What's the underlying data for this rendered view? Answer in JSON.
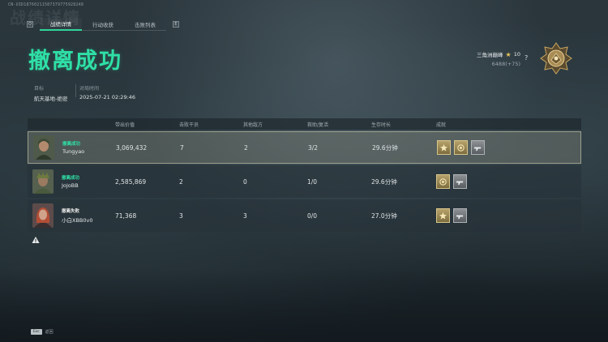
{
  "uid": "CN-UID18760211587379775928248",
  "ghost_title": "战绩详情",
  "tabbar": {
    "left_key": "Q",
    "right_key": "E",
    "tabs": [
      {
        "label": "战绩详情",
        "active": true
      },
      {
        "label": "行动收获",
        "active": false
      },
      {
        "label": "击败列表",
        "active": false
      }
    ]
  },
  "headline": "撤离成功",
  "meta": {
    "target_label": "目标",
    "target_value": "航天基地-绝密",
    "time_label": "对局时间",
    "time_value": "2025-07-21 02:29:46"
  },
  "rank": {
    "name": "三角洲巅峰",
    "stars": "10",
    "points": "6488(+75)",
    "help": "?"
  },
  "table": {
    "headers": [
      "带出价值",
      "击败干员",
      "其他敌方",
      "救助/复活",
      "生存时长",
      "成就"
    ],
    "rows": [
      {
        "status": "撤离成功",
        "status_type": "ok",
        "name": "Tungyao",
        "value": "3,069,432",
        "kills": "7",
        "other": "2",
        "rescue": "3/2",
        "time": "29.6分钟",
        "achievements": [
          "gold-star",
          "gold-medal",
          "grey-gun"
        ],
        "me": true
      },
      {
        "status": "撤离成功",
        "status_type": "ok",
        "name": "JoJoBB",
        "value": "2,585,869",
        "kills": "2",
        "other": "0",
        "rescue": "1/0",
        "time": "29.6分钟",
        "achievements": [
          "gold-medal",
          "grey-gun"
        ],
        "me": false
      },
      {
        "status": "撤离失败",
        "status_type": "fail",
        "name": "小白XBB0v0",
        "value": "71,368",
        "kills": "3",
        "other": "3",
        "rescue": "0/0",
        "time": "27.0分钟",
        "achievements": [
          "gold-star",
          "grey-gun"
        ],
        "me": false
      }
    ]
  },
  "footer": {
    "esc_key": "Esc",
    "esc_label": "返回"
  },
  "colors": {
    "accent": "#2fe0a6",
    "gold": "#b7a26a",
    "grey": "#8d9194"
  }
}
